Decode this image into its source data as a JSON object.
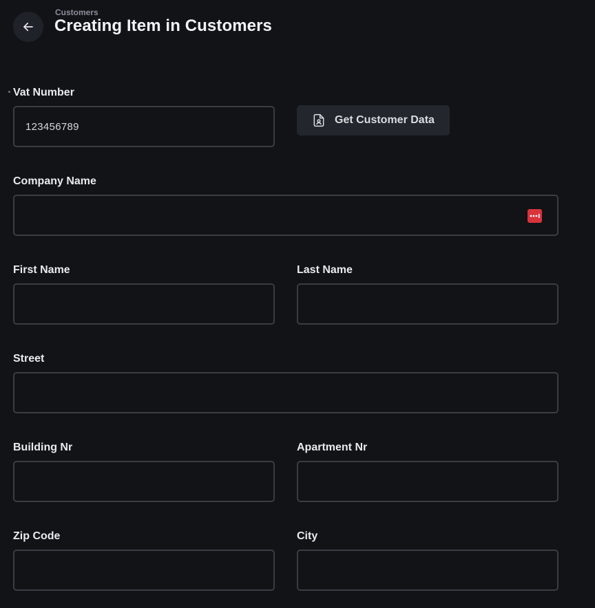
{
  "header": {
    "breadcrumb": "Customers",
    "title": "Creating Item in Customers"
  },
  "form": {
    "vat_number": {
      "label": "Vat Number",
      "value": "123456789",
      "required": true
    },
    "get_customer_data_label": "Get Customer Data",
    "company_name": {
      "label": "Company Name",
      "value": ""
    },
    "first_name": {
      "label": "First Name",
      "value": ""
    },
    "last_name": {
      "label": "Last Name",
      "value": ""
    },
    "street": {
      "label": "Street",
      "value": ""
    },
    "building_nr": {
      "label": "Building Nr",
      "value": ""
    },
    "apartment_nr": {
      "label": "Apartment Nr",
      "value": ""
    },
    "zip_code": {
      "label": "Zip Code",
      "value": ""
    },
    "city": {
      "label": "City",
      "value": ""
    }
  },
  "icons": {
    "back": "arrow-left-icon",
    "get_data": "document-user-icon",
    "password_manager": "password-manager-icon"
  },
  "colors": {
    "background": "#111317",
    "field_border": "#3a3d43",
    "button_bg": "#23262c",
    "password_icon": "#d9333b"
  }
}
